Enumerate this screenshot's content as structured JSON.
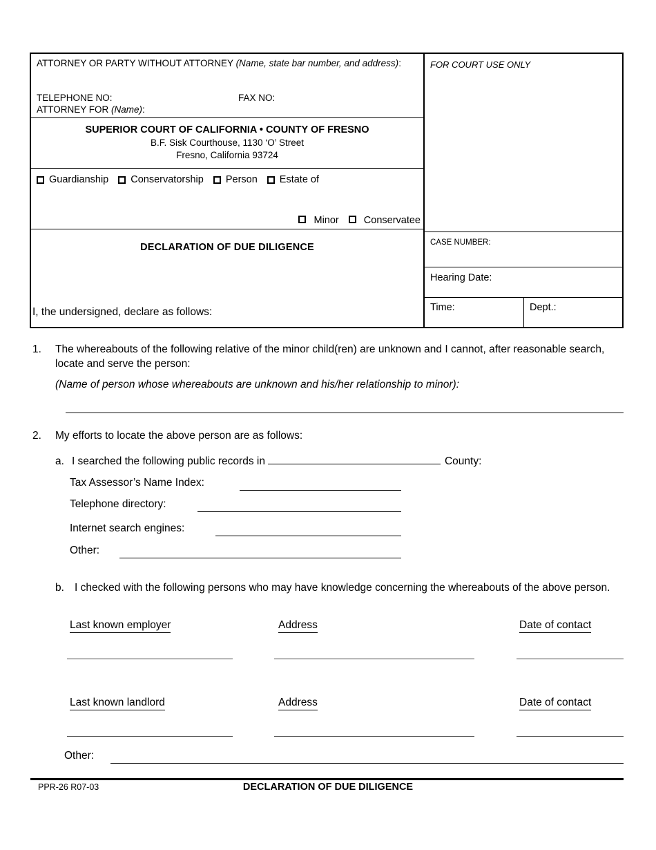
{
  "caption": {
    "attorney_header": "ATTORNEY OR PARTY WITHOUT ATTORNEY ",
    "attorney_header_italic": "(Name, state bar number, and address)",
    "attorney_header_end": ":",
    "telephone_label": "TELEPHONE NO:",
    "fax_label": "FAX NO:",
    "attorney_for_label": "ATTORNEY FOR ",
    "attorney_for_italic": "(Name)",
    "attorney_for_end": ":",
    "court_name": "SUPERIOR COURT OF CALIFORNIA • COUNTY OF FRESNO",
    "court_address_line1": "B.F. Sisk Courthouse, 1130 ‘O’ Street",
    "court_address_line2": "Fresno, California 93724",
    "checkboxes_top": [
      {
        "label": "Guardianship",
        "checked": false
      },
      {
        "label": "Conservatorship",
        "checked": false
      },
      {
        "label": "Person",
        "checked": false
      },
      {
        "label": "Estate of",
        "checked": false
      }
    ],
    "checkboxes_bottom": [
      {
        "label": "Minor",
        "checked": false
      },
      {
        "label": "Conservatee",
        "checked": false
      }
    ],
    "form_title": "DECLARATION OF DUE DILIGENCE",
    "for_court_use_only": "FOR COURT USE ONLY",
    "case_number_label": "CASE NUMBER:",
    "case_number_value": "",
    "hearing_date_label": "Hearing Date:",
    "hearing_date_value": "",
    "time_label": "Time:",
    "time_value": "",
    "dept_label": "Dept.:",
    "dept_value": ""
  },
  "body": {
    "undersigned": "I, the undersigned, declare as follows:",
    "item1": {
      "number": "1.",
      "text": "The whereabouts of the following relative of the minor child(ren) are unknown and I cannot, after reasonable search, locate and serve the person:",
      "hint": "(Name of person whose whereabouts are unknown and his/her relationship to minor):",
      "answer": ""
    },
    "item2": {
      "number": "2.",
      "text": "My efforts to locate the above person are as follows:",
      "sub_a": {
        "label": "a.",
        "text_before": "I searched the following public records in",
        "county_value": "",
        "text_after": "County:",
        "records": [
          {
            "label": "Tax Assessor’s Name Index:",
            "value": ""
          },
          {
            "label": "Telephone directory:",
            "value": ""
          },
          {
            "label": "Internet search engines:",
            "value": ""
          },
          {
            "label": "Other:",
            "value": ""
          }
        ]
      },
      "sub_b": {
        "label": "b.",
        "text": "I checked with the following persons who may have knowledge concerning the whereabouts of the above person.",
        "tables": [
          {
            "columns": [
              "Last known employer",
              "Address",
              "Date of contact"
            ],
            "row": [
              "",
              "",
              ""
            ]
          },
          {
            "columns": [
              "Last known landlord",
              "Address",
              "Date of contact"
            ],
            "row": [
              "",
              "",
              ""
            ]
          }
        ],
        "other_label": "Other:",
        "other_value": ""
      }
    }
  },
  "footer": {
    "form_code": "PPR-26 R07-03",
    "title": "DECLARATION OF DUE DILIGENCE"
  },
  "colors": {
    "ink": "#000000",
    "rule_grey": "#8c8c8c",
    "fill_line": "#444444",
    "paper": "#ffffff"
  }
}
